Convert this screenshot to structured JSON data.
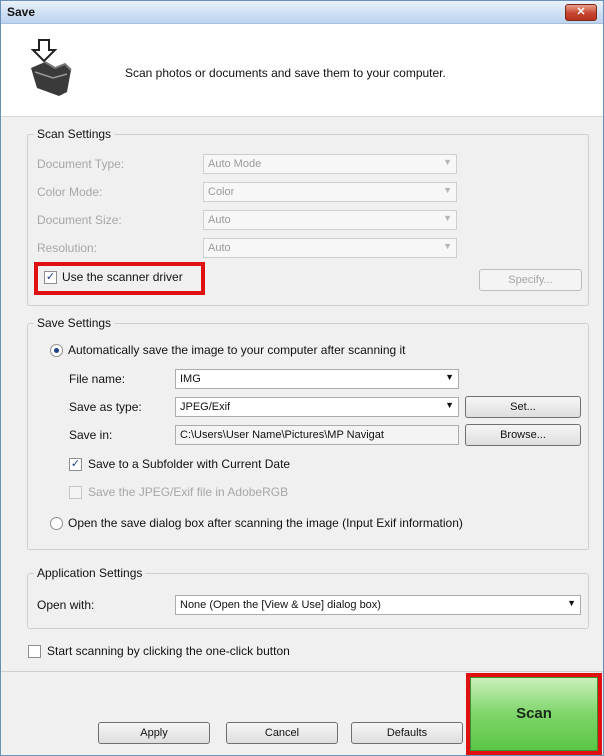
{
  "window": {
    "title": "Save",
    "close_label": "✕"
  },
  "header": {
    "description": "Scan photos or documents and save them to your computer.",
    "icon": "scan-save-icon"
  },
  "scan_settings": {
    "legend": "Scan Settings",
    "document_type_label": "Document Type:",
    "document_type_value": "Auto Mode",
    "color_mode_label": "Color Mode:",
    "color_mode_value": "Color",
    "document_size_label": "Document Size:",
    "document_size_value": "Auto",
    "resolution_label": "Resolution:",
    "resolution_value": "Auto",
    "use_driver_label": "Use the scanner driver",
    "use_driver_checked": true,
    "specify_label": "Specify..."
  },
  "save_settings": {
    "legend": "Save Settings",
    "auto_save_label": "Automatically save the image to your computer after scanning it",
    "file_name_label": "File name:",
    "file_name_value": "IMG",
    "save_as_type_label": "Save as type:",
    "save_as_type_value": "JPEG/Exif",
    "set_label": "Set...",
    "save_in_label": "Save in:",
    "save_in_value": "C:\\Users\\User Name\\Pictures\\MP Navigat",
    "browse_label": "Browse...",
    "subfolder_label": "Save to a Subfolder with Current Date",
    "adobergb_label": "Save the JPEG/Exif file in AdobeRGB",
    "open_dialog_label": "Open the save dialog box after scanning the image (Input Exif information)"
  },
  "application_settings": {
    "legend": "Application Settings",
    "open_with_label": "Open with:",
    "open_with_value": "None (Open the [View & Use] dialog box)"
  },
  "one_click_label": "Start scanning by clicking the one-click button",
  "buttons": {
    "apply": "Apply",
    "cancel": "Cancel",
    "defaults": "Defaults",
    "scan": "Scan"
  },
  "colors": {
    "highlight": "#e01010",
    "scan_button": "#7fd56a",
    "title_bar": "#cfe0f3"
  }
}
